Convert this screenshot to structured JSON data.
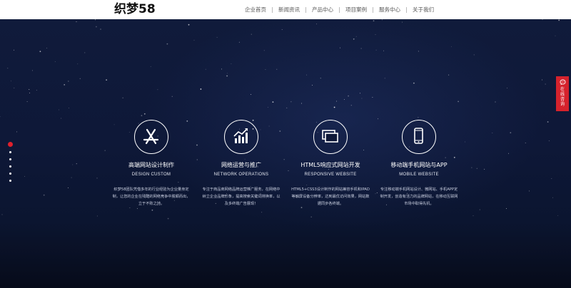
{
  "header": {
    "logo": "织梦58",
    "nav": [
      "企业首页",
      "新闻资讯",
      "产品中心",
      "项目案例",
      "服务中心",
      "关于我们"
    ]
  },
  "slider": {
    "dot_count": 6,
    "active_index": 0
  },
  "services": [
    {
      "icon": "app-store-icon",
      "title": "高端网站设计制作",
      "subtitle": "DESIGN CUSTOM",
      "desc": "织梦58团队凭借多年的行业经验为企业量身定制，让您的企业在残酷的网络竞争中脱颖而出，立于不败之地。"
    },
    {
      "icon": "growth-chart-icon",
      "title": "网络运营与推广",
      "subtitle": "NETWORK OPERATIONS",
      "desc": "专注于商品商网络品牌运营推广服务，在网络中树立企业品牌形象，提高搜索关键词排换率，以及多终端广告展现！"
    },
    {
      "icon": "windows-icon",
      "title": "HTML5响应式网站开发",
      "subtitle": "RESPONSIVE WEBSITE",
      "desc": "HTML5+CSS3设计制作的网站兼容手机和IPAD等触屏设备分辨率，达到最优访问效果，网站数据同步各终端。"
    },
    {
      "icon": "smartphone-icon",
      "title": "移动端手机网站与APP",
      "subtitle": "MOBILE WEBSITE",
      "desc": "专注移动端手机网站设计、微网站、手机APP定制开发，创造有活力的品牌网站，在移动互联网市场中取得先机。"
    }
  ],
  "consult": {
    "label": "在线咨询"
  },
  "colors": {
    "accent": "#d5222c",
    "background": "#0c1633",
    "header_bg": "#ffffff"
  }
}
